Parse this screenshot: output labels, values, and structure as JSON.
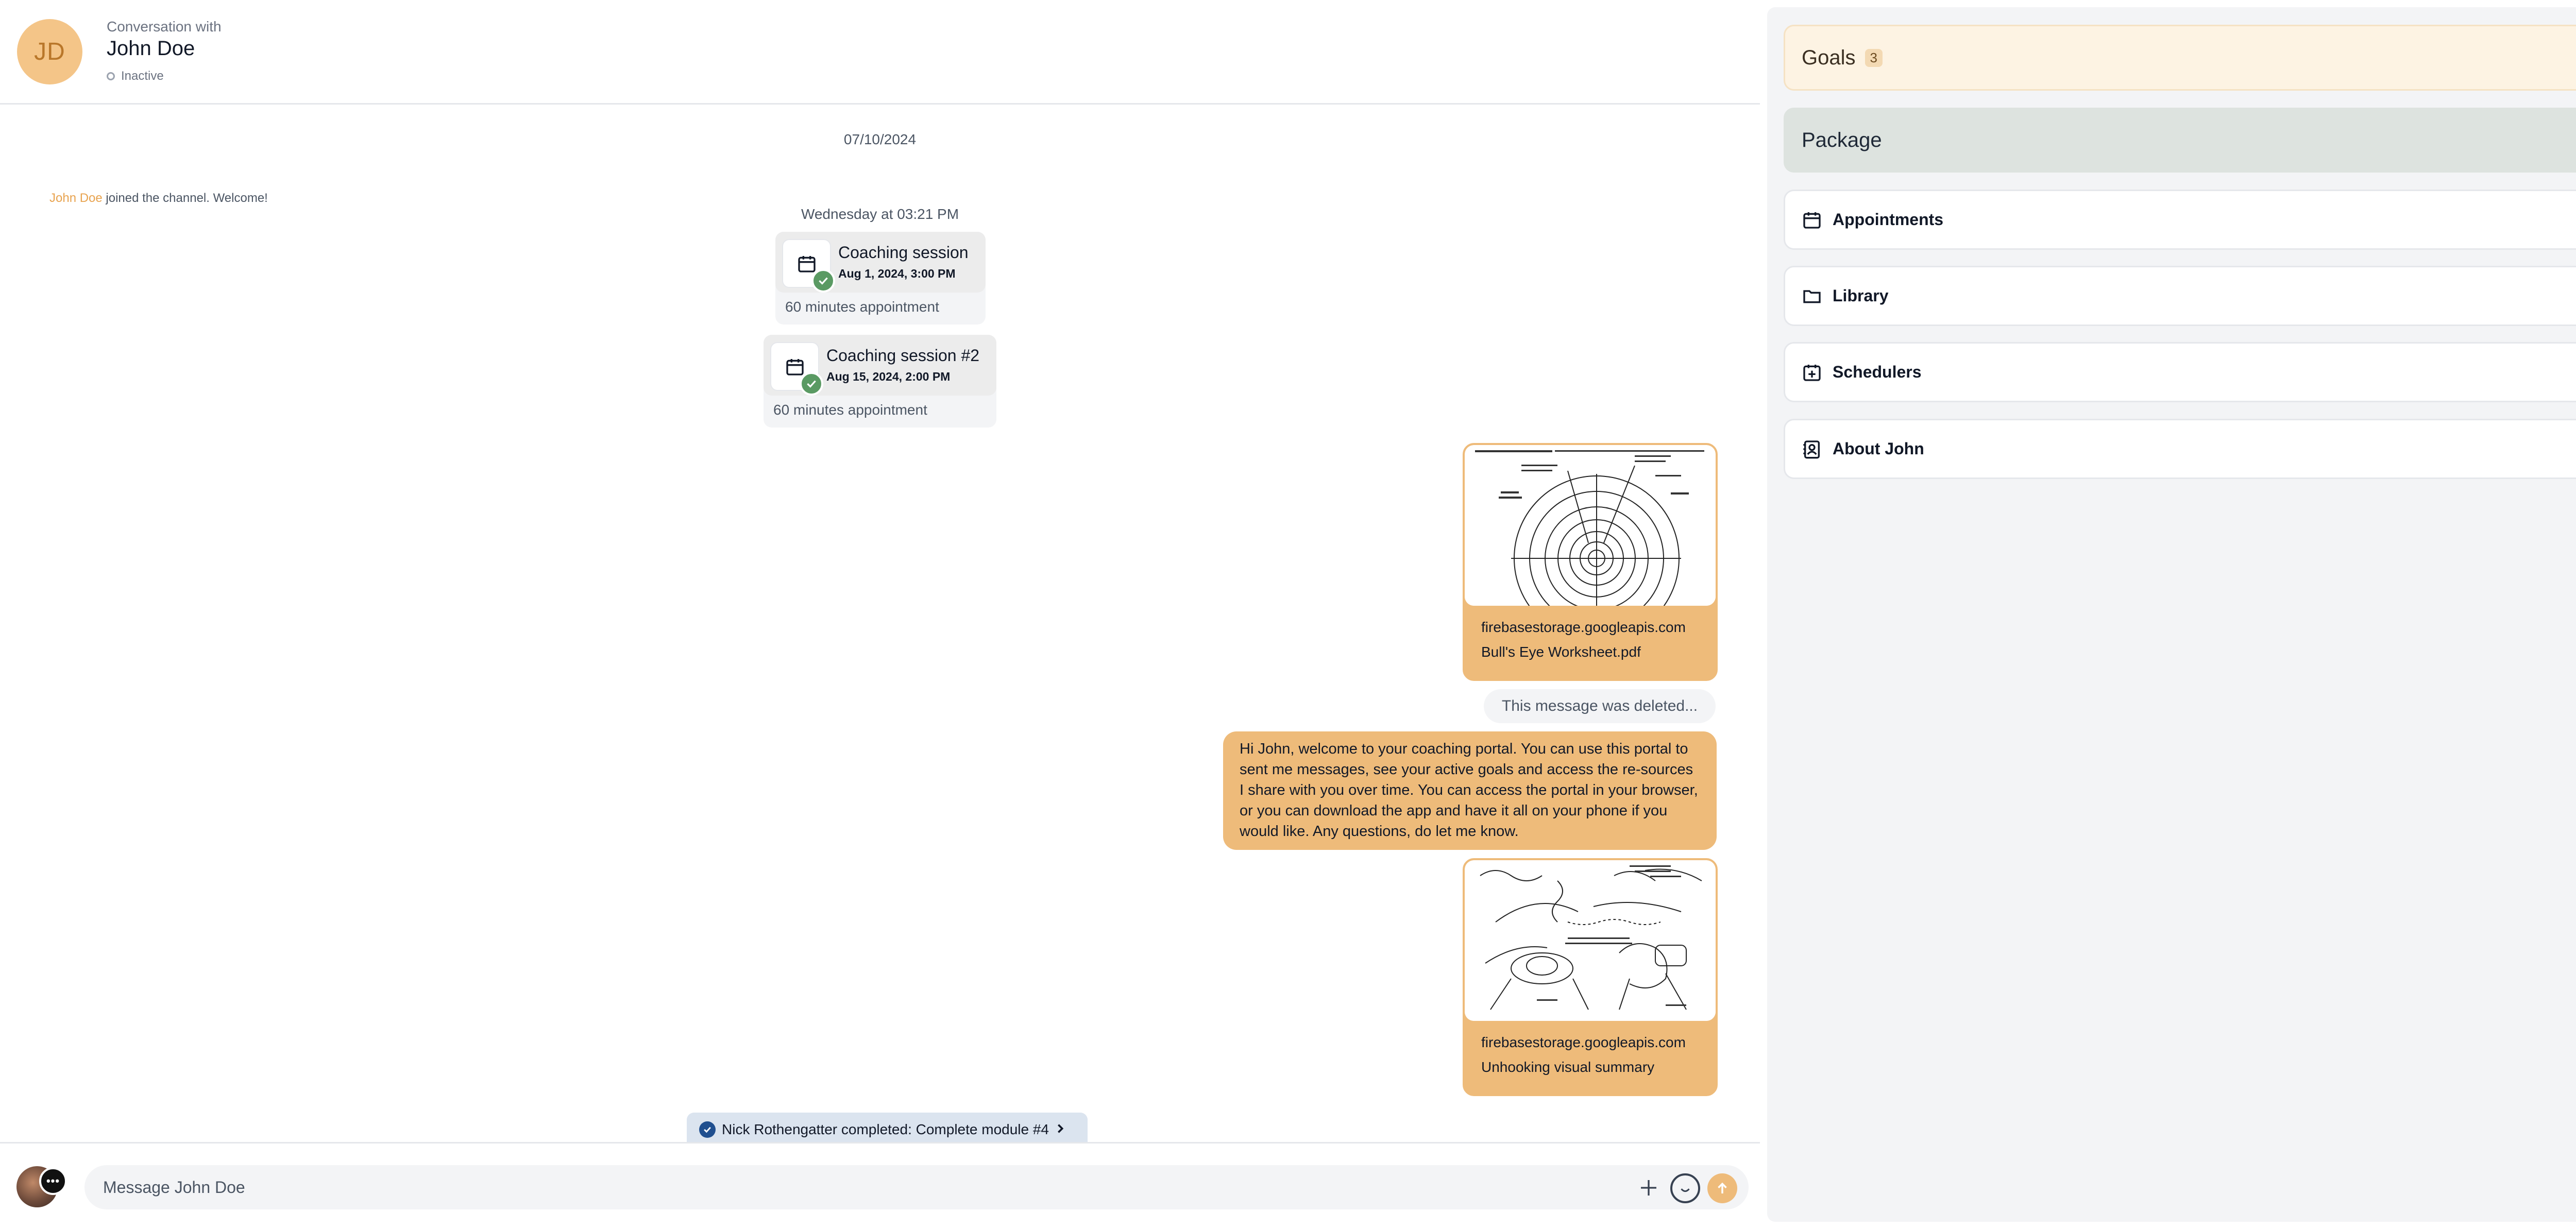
{
  "header": {
    "avatar_initials": "JD",
    "conversation_with": "Conversation with",
    "contact_name": "John Doe",
    "status": "Inactive"
  },
  "chat": {
    "date_separator": "07/10/2024",
    "join_message": {
      "name": "John Doe",
      "text": " joined the channel. Welcome!"
    },
    "timestamp": "Wednesday at 03:21 PM",
    "appointments": [
      {
        "title": "Coaching session",
        "when": "Aug 1, 2024, 3:00 PM",
        "duration": "60 minutes appointment"
      },
      {
        "title": "Coaching session #2",
        "when": "Aug 15, 2024, 2:00 PM",
        "duration": "60 minutes appointment"
      }
    ],
    "files": [
      {
        "domain": "firebasestorage.googleapis.com",
        "name": "Bull's Eye Worksheet.pdf"
      },
      {
        "domain": "firebasestorage.googleapis.com",
        "name": "Unhooking visual summary"
      }
    ],
    "deleted_message": "This message was deleted...",
    "welcome_message": "Hi John, welcome to your coaching portal. You can use this portal to sent me messages, see your active goals and access the re-sources I share with you over time. You can access the portal in your browser, or you can download the app and have it all on your phone if you would like. Any questions, do let me know.",
    "goal_completed": "Nick Rothengatter completed: Complete module #4"
  },
  "composer": {
    "placeholder": "Message John Doe",
    "bubble_icon_text": "•••"
  },
  "sidebar": {
    "goals": {
      "label": "Goals",
      "count": "3"
    },
    "package": {
      "label": "Package"
    },
    "appointments": {
      "label": "Appointments"
    },
    "library": {
      "label": "Library"
    },
    "schedulers": {
      "label": "Schedulers"
    },
    "about": {
      "label": "About John"
    }
  },
  "colors": {
    "accent": "#eebb7a",
    "avatar_bg": "#f4c588",
    "goals_bg": "#fdf3e3",
    "package_bg": "#dde3df",
    "check_green": "#5a9a63",
    "goal_pill_bg": "#dbe4ef"
  },
  "icons": [
    "calendar-icon",
    "check-icon",
    "folder-icon",
    "scheduler-icon",
    "contact-card-icon",
    "chevron-updown-icon",
    "plus-icon",
    "emoji-icon",
    "send-arrow-icon",
    "chat-bubble-icon",
    "checkmark-badge-icon",
    "chevron-right-icon"
  ]
}
